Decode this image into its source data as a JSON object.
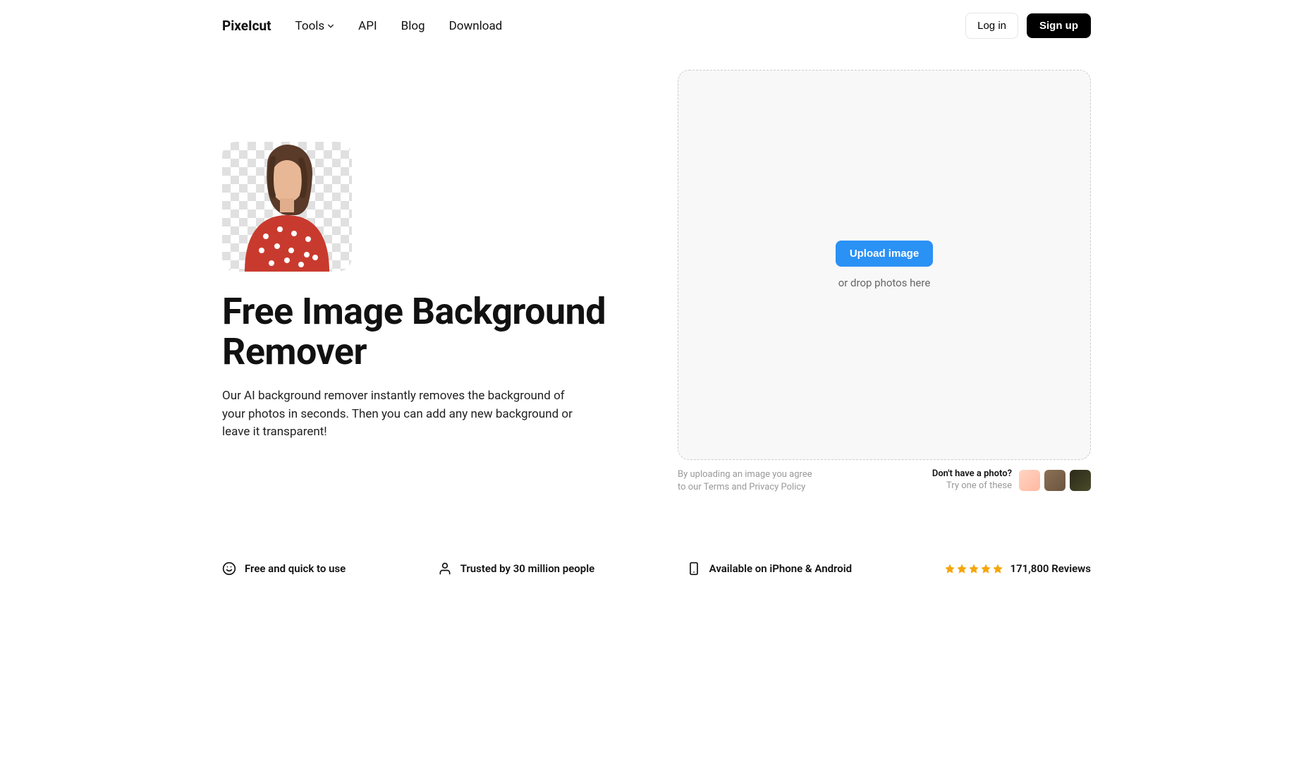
{
  "brand": "PixeIcut",
  "nav": {
    "tools": "Tools",
    "api": "API",
    "blog": "Blog",
    "download": "Download"
  },
  "auth": {
    "login": "Log in",
    "signup": "Sign up"
  },
  "hero": {
    "title": "Free Image Background Remover",
    "description": "Our AI background remover instantly removes the background of your photos in seconds. Then you can add any new background or leave it transparent!"
  },
  "upload": {
    "button": "Upload image",
    "drop_hint": "or drop photos here",
    "terms": "By uploading an image you agree to our Terms and Privacy Policy"
  },
  "samples": {
    "title": "Don't have a photo?",
    "subtitle": "Try one of these"
  },
  "features": {
    "free": "Free and quick to use",
    "trusted": "Trusted by 30 million people",
    "mobile": "Available on iPhone & Android",
    "reviews": "171,800 Reviews"
  }
}
